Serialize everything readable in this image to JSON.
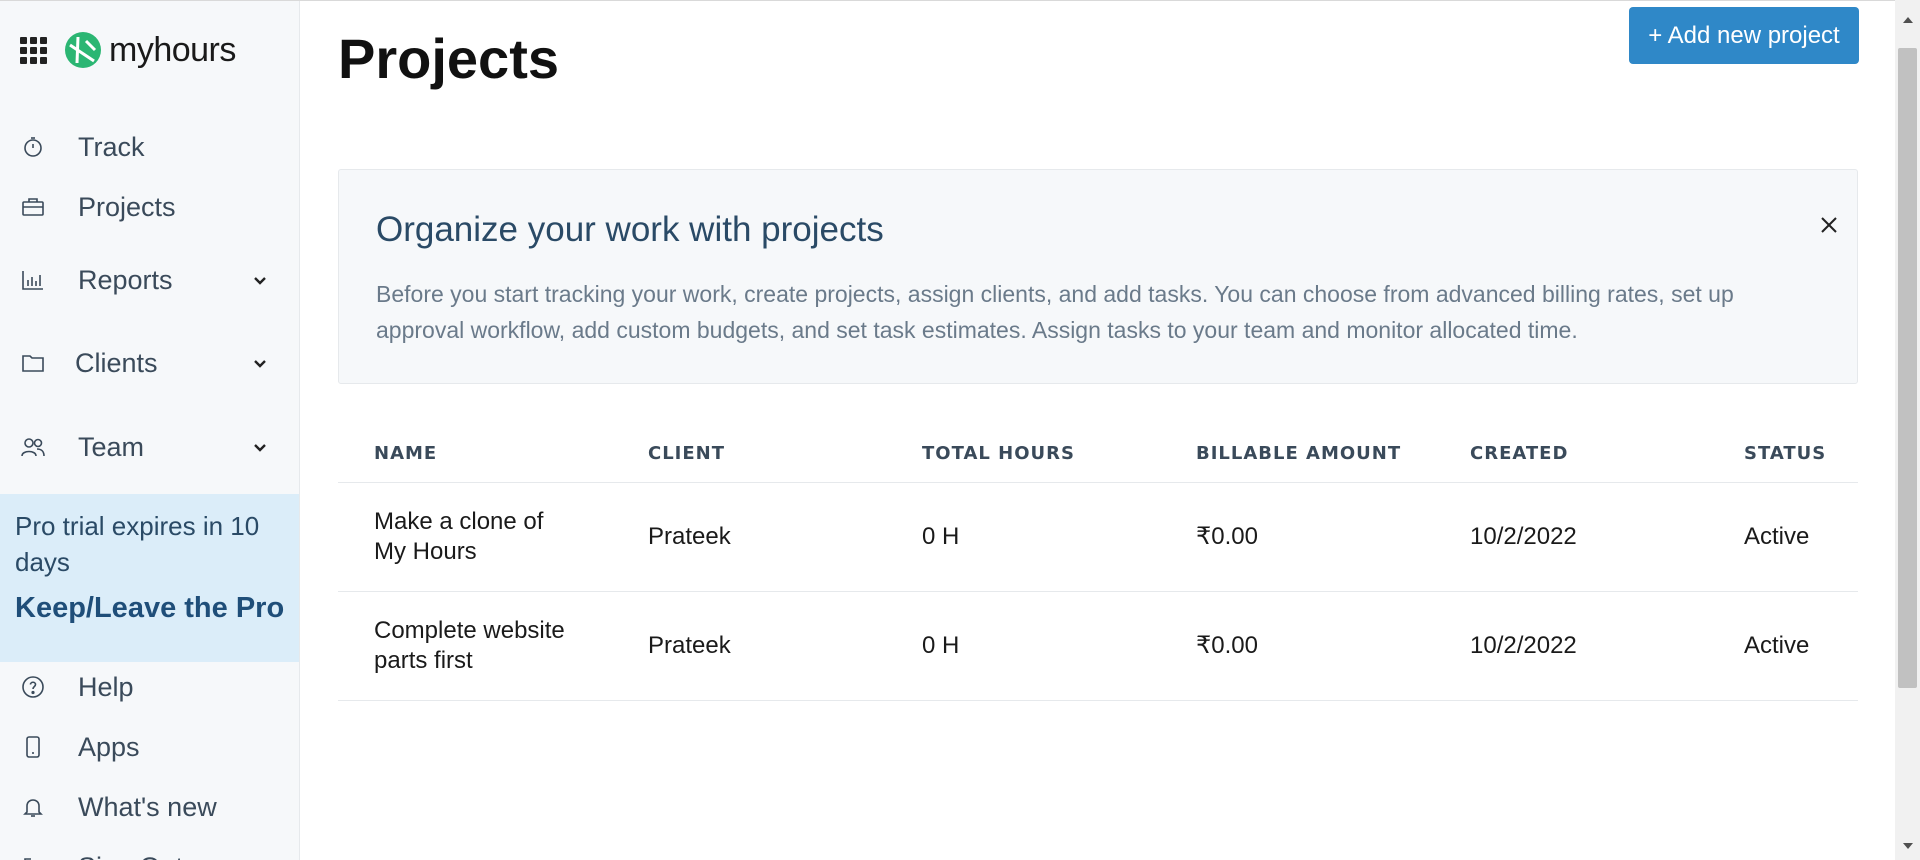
{
  "app": {
    "name": "myhours"
  },
  "sidebar": {
    "items": [
      {
        "label": "Track",
        "icon": "stopwatch-icon"
      },
      {
        "label": "Projects",
        "icon": "briefcase-icon"
      },
      {
        "label": "Reports",
        "icon": "bar-chart-icon",
        "expandable": true
      },
      {
        "label": "Clients",
        "icon": "folder-icon",
        "expandable": true
      },
      {
        "label": "Team",
        "icon": "people-icon",
        "expandable": true
      }
    ],
    "promo": {
      "text": "Pro trial expires in 10 days",
      "link": "Keep/Leave the Pro"
    },
    "footer_items": [
      {
        "label": "Help",
        "icon": "help-circle-icon"
      },
      {
        "label": "Apps",
        "icon": "phone-icon"
      },
      {
        "label": "What's new",
        "icon": "bell-icon"
      },
      {
        "label": "Sign Out",
        "icon": "sign-out-icon"
      }
    ]
  },
  "main": {
    "title": "Projects",
    "add_button": "+ Add new project",
    "info_card": {
      "title": "Organize your work with projects",
      "body": "Before you start tracking your work, create projects, assign clients, and add tasks. You can choose from advanced billing rates, set up approval workflow, add custom budgets, and set task estimates. Assign tasks to your team and monitor allocated time."
    },
    "table": {
      "headers": [
        "NAME",
        "CLIENT",
        "TOTAL HOURS",
        "BILLABLE AMOUNT",
        "CREATED",
        "STATUS"
      ],
      "rows": [
        {
          "name": "Make a clone of My Hours",
          "client": "Prateek",
          "total_hours": "0 H",
          "billable": "₹0.00",
          "created": "10/2/2022",
          "status": "Active"
        },
        {
          "name": "Complete website parts first",
          "client": "Prateek",
          "total_hours": "0 H",
          "billable": "₹0.00",
          "created": "10/2/2022",
          "status": "Active"
        }
      ]
    }
  },
  "colors": {
    "accent": "#2f88c8",
    "logo_green": "#2bb673",
    "promo_bg": "#dbedf9",
    "heading_blue": "#2a4a66"
  }
}
